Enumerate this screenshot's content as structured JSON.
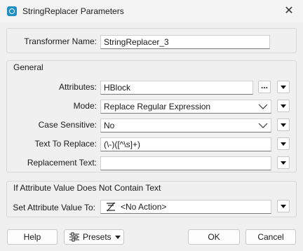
{
  "window": {
    "title": "StringReplacer Parameters",
    "close_glyph": "✕"
  },
  "transformer": {
    "label": "Transformer Name:",
    "value": "StringReplacer_3"
  },
  "general": {
    "title": "General",
    "attributes": {
      "label": "Attributes:",
      "value": "HBlock",
      "browse_label": "..."
    },
    "mode": {
      "label": "Mode:",
      "value": "Replace Regular Expression"
    },
    "case_sensitive": {
      "label": "Case Sensitive:",
      "value": "No"
    },
    "text_to_replace": {
      "label": "Text To Replace:",
      "value": "(\\-)([^\\s]+)"
    },
    "replacement_text": {
      "label": "Replacement Text:",
      "value": ""
    }
  },
  "if_not_contain": {
    "title": "If Attribute Value Does Not Contain Text",
    "set_value": {
      "label": "Set Attribute Value To:",
      "value": "<No Action>",
      "icon": "no-action-icon"
    }
  },
  "footer": {
    "help": "Help",
    "presets": "Presets",
    "ok": "OK",
    "cancel": "Cancel"
  }
}
